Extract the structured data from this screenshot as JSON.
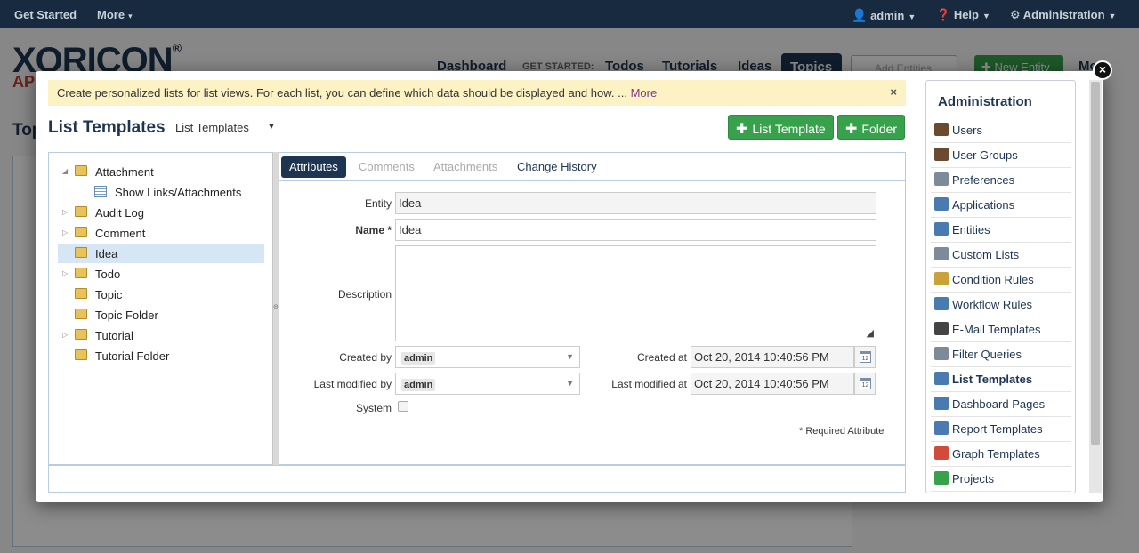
{
  "topbar": {
    "get_started": "Get Started",
    "more": "More",
    "user": "admin",
    "help": "Help",
    "administration": "Administration"
  },
  "background": {
    "logo": "XORICON",
    "logo_sub": "AP",
    "nav": [
      "Dashboard",
      "GET STARTED:",
      "Todos",
      "Tutorials",
      "Ideas",
      "Topics"
    ],
    "search_placeholder": "Add Entities",
    "new_entity": "New Entity",
    "more": "Mo",
    "page_title": "Top"
  },
  "infobar": {
    "text": "Create personalized lists for list views. For each list, you can define which data should be displayed and how. ...",
    "more_link": "More",
    "close": "×"
  },
  "header": {
    "title": "List Templates",
    "selector_value": "List Templates",
    "add_list_template": "List Template",
    "add_folder": "Folder"
  },
  "tree": [
    {
      "label": "Attachment",
      "type": "folder",
      "expander": "open"
    },
    {
      "label": "Show Links/Attachments",
      "type": "list",
      "expander": ""
    },
    {
      "label": "Audit Log",
      "type": "folder",
      "expander": "closed"
    },
    {
      "label": "Comment",
      "type": "folder",
      "expander": "closed"
    },
    {
      "label": "Idea",
      "type": "folder",
      "expander": "",
      "selected": true
    },
    {
      "label": "Todo",
      "type": "folder",
      "expander": "closed"
    },
    {
      "label": "Topic",
      "type": "folder",
      "expander": ""
    },
    {
      "label": "Topic Folder",
      "type": "folder",
      "expander": ""
    },
    {
      "label": "Tutorial",
      "type": "folder",
      "expander": "closed"
    },
    {
      "label": "Tutorial Folder",
      "type": "folder",
      "expander": ""
    }
  ],
  "tabs": [
    "Attributes",
    "Comments",
    "Attachments",
    "Change History"
  ],
  "form": {
    "entity_label": "Entity",
    "entity_value": "Idea",
    "name_label": "Name *",
    "name_value": "Idea",
    "description_label": "Description",
    "description_value": "",
    "created_by_label": "Created by",
    "created_by_value": "admin",
    "last_modified_by_label": "Last modified by",
    "last_modified_by_value": "admin",
    "created_at_label": "Created at",
    "created_at_value": "Oct 20, 2014 10:40:56 PM",
    "last_modified_at_label": "Last modified at",
    "last_modified_at_value": "Oct 20, 2014 10:40:56 PM",
    "system_label": "System",
    "required_note": "* Required Attribute",
    "calendar_day": "12"
  },
  "admin": {
    "title": "Administration",
    "items": [
      {
        "label": "Users",
        "icon": "user-icon",
        "color": "#6b4a2f"
      },
      {
        "label": "User Groups",
        "icon": "user-groups-icon",
        "color": "#6b4a2f"
      },
      {
        "label": "Preferences",
        "icon": "tools-icon",
        "color": "#7d8a99"
      },
      {
        "label": "Applications",
        "icon": "window-icon",
        "color": "#4a7bb0"
      },
      {
        "label": "Entities",
        "icon": "gear-icon",
        "color": "#4a7bb0"
      },
      {
        "label": "Custom Lists",
        "icon": "search-list-icon",
        "color": "#7d8a99"
      },
      {
        "label": "Condition Rules",
        "icon": "condition-icon",
        "color": "#c9a23a"
      },
      {
        "label": "Workflow Rules",
        "icon": "workflow-icon",
        "color": "#4a7bb0"
      },
      {
        "label": "E-Mail Templates",
        "icon": "envelope-icon",
        "color": "#444"
      },
      {
        "label": "Filter Queries",
        "icon": "filter-icon",
        "color": "#7d8a99"
      },
      {
        "label": "List Templates",
        "icon": "list-icon",
        "color": "#4a7bb0",
        "current": true
      },
      {
        "label": "Dashboard Pages",
        "icon": "dashboard-icon",
        "color": "#4a7bb0"
      },
      {
        "label": "Report Templates",
        "icon": "report-icon",
        "color": "#4a7bb0"
      },
      {
        "label": "Graph Templates",
        "icon": "pie-chart-icon",
        "color": "#d24a3a"
      },
      {
        "label": "Projects",
        "icon": "projects-icon",
        "color": "#38a14b"
      }
    ]
  },
  "colors": {
    "navy": "#1d3550",
    "green": "#38a14b",
    "info_bg": "#fcf2c4",
    "selected_bg": "#d6e6f5"
  },
  "close_icon": "×"
}
